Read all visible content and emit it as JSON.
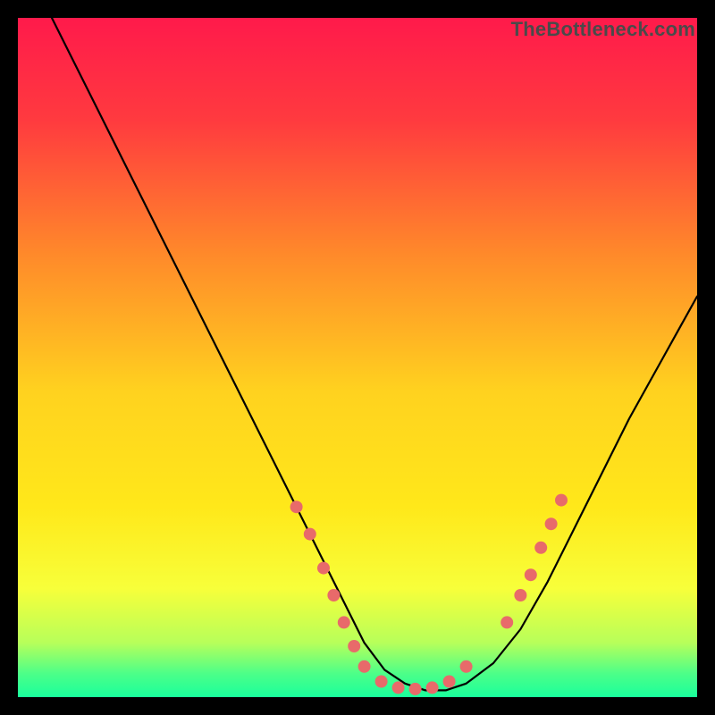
{
  "watermark": "TheBottleneck.com",
  "chart_data": {
    "type": "line",
    "title": "",
    "xlabel": "",
    "ylabel": "",
    "xlim": [
      0,
      100
    ],
    "ylim": [
      0,
      100
    ],
    "gradient_stops": [
      {
        "offset": 0.0,
        "color": "#ff1a4b"
      },
      {
        "offset": 0.15,
        "color": "#ff3a3f"
      },
      {
        "offset": 0.35,
        "color": "#ff8a2a"
      },
      {
        "offset": 0.55,
        "color": "#ffd21f"
      },
      {
        "offset": 0.72,
        "color": "#ffe81a"
      },
      {
        "offset": 0.84,
        "color": "#f7ff3a"
      },
      {
        "offset": 0.92,
        "color": "#b7ff5a"
      },
      {
        "offset": 0.965,
        "color": "#4dff88"
      },
      {
        "offset": 1.0,
        "color": "#19ff9c"
      }
    ],
    "series": [
      {
        "name": "curve",
        "x": [
          5,
          8,
          12,
          16,
          20,
          24,
          28,
          32,
          36,
          40,
          44,
          48,
          51,
          54,
          57,
          60,
          63,
          66,
          70,
          74,
          78,
          82,
          86,
          90,
          95,
          100
        ],
        "y": [
          100,
          94,
          86,
          78,
          70,
          62,
          54,
          46,
          38,
          30,
          22,
          14,
          8,
          4,
          2,
          1,
          1,
          2,
          5,
          10,
          17,
          25,
          33,
          41,
          50,
          59
        ]
      }
    ],
    "markers": {
      "name": "highlight-points",
      "color": "#e86a6a",
      "radius_px": 7,
      "points": [
        {
          "x": 41,
          "y": 28
        },
        {
          "x": 43,
          "y": 24
        },
        {
          "x": 45,
          "y": 19
        },
        {
          "x": 46.5,
          "y": 15
        },
        {
          "x": 48,
          "y": 11
        },
        {
          "x": 49.5,
          "y": 7.5
        },
        {
          "x": 51,
          "y": 4.5
        },
        {
          "x": 53.5,
          "y": 2.3
        },
        {
          "x": 56,
          "y": 1.4
        },
        {
          "x": 58.5,
          "y": 1.2
        },
        {
          "x": 61,
          "y": 1.4
        },
        {
          "x": 63.5,
          "y": 2.3
        },
        {
          "x": 66,
          "y": 4.5
        },
        {
          "x": 72,
          "y": 11
        },
        {
          "x": 74,
          "y": 15
        },
        {
          "x": 75.5,
          "y": 18
        },
        {
          "x": 77,
          "y": 22
        },
        {
          "x": 78.5,
          "y": 25.5
        },
        {
          "x": 80,
          "y": 29
        }
      ]
    }
  }
}
